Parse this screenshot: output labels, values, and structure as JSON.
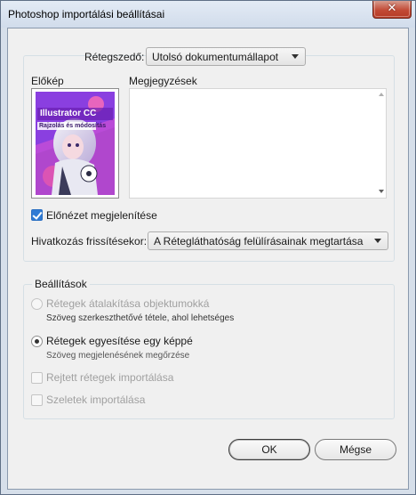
{
  "window": {
    "title": "Photoshop importálási beállításai"
  },
  "top": {
    "layer_comp_label": "Rétegszedő:",
    "layer_comp_value": "Utolsó dokumentumállapot",
    "preview_label": "Előkép",
    "comments_label": "Megjegyzések",
    "preview_art": {
      "app_name": "Illustrator CC",
      "subtitle": "Rajzolás és módosítás"
    },
    "show_preview_label": "Előnézet megjelenítése",
    "show_preview_checked": true,
    "link_update_label": "Hivatkozás frissítésekor:",
    "link_update_value": "A Rétegláthatóság felülírásainak megtartása"
  },
  "settings": {
    "legend": "Beállítások",
    "options": [
      {
        "label": "Rétegek átalakítása objektumokká",
        "sub": "Szöveg szerkeszthetővé tétele, ahol lehetséges",
        "selected": false,
        "enabled": false
      },
      {
        "label": "Rétegek egyesítése egy képpé",
        "sub": "Szöveg megjelenésének megőrzése",
        "selected": true,
        "enabled": true
      }
    ],
    "import_hidden_label": "Rejtett rétegek importálása",
    "import_slices_label": "Szeletek importálása"
  },
  "buttons": {
    "ok": "OK",
    "cancel": "Mégse"
  },
  "colors": {
    "accent": "#2f7bd5",
    "title_bar": "#d6dfea",
    "close_button": "#c24a35"
  }
}
